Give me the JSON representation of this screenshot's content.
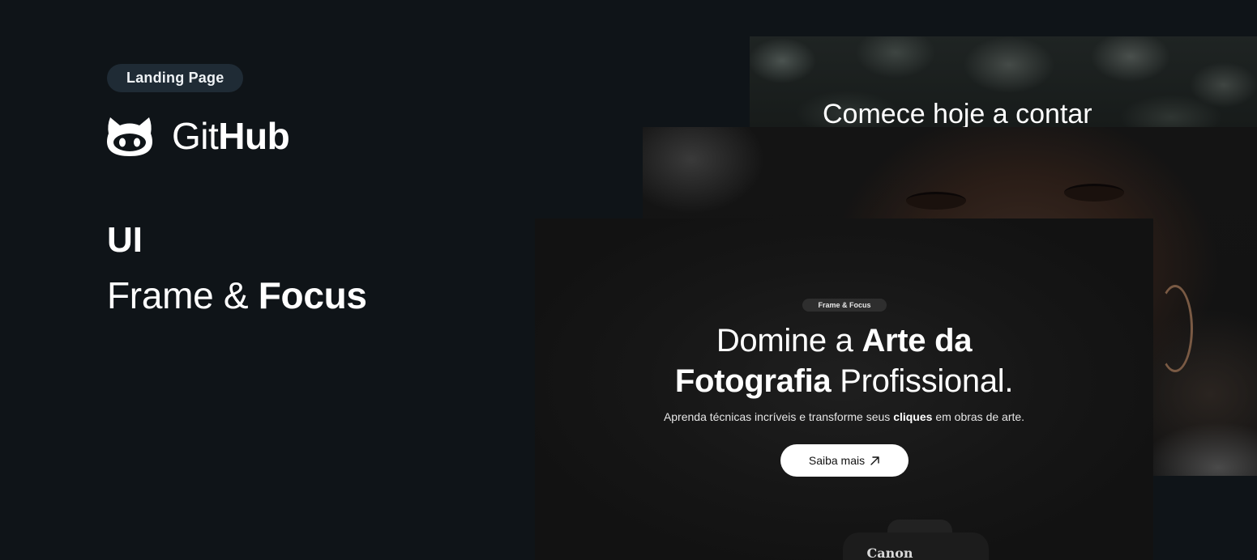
{
  "badge": {
    "label": "Landing Page"
  },
  "brand": {
    "name_light": "Git",
    "name_bold": "Hub",
    "icon": "github-cat-icon"
  },
  "category": {
    "label": "UI"
  },
  "project": {
    "title_light": "Frame & ",
    "title_bold": "Focus"
  },
  "mockups": {
    "forest": {
      "heading": "Comece hoje a contar"
    },
    "main": {
      "badge": "Frame & Focus",
      "headline_line1_light": "Domine a ",
      "headline_line1_bold": "Arte da",
      "headline_line2_bold": "Fotografia",
      "headline_line2_light": " Profissional.",
      "subline_before": "Aprenda técnicas incríveis e transforme seus ",
      "subline_bold": "cliques",
      "subline_after": " em obras de arte.",
      "cta_label": "Saiba mais",
      "cta_icon": "arrow-up-right-icon",
      "camera_brand": "Canon"
    }
  },
  "colors": {
    "background": "#0f1418",
    "badge_bg": "#1f2b35",
    "text": "#ffffff",
    "cta_bg": "#ffffff"
  }
}
